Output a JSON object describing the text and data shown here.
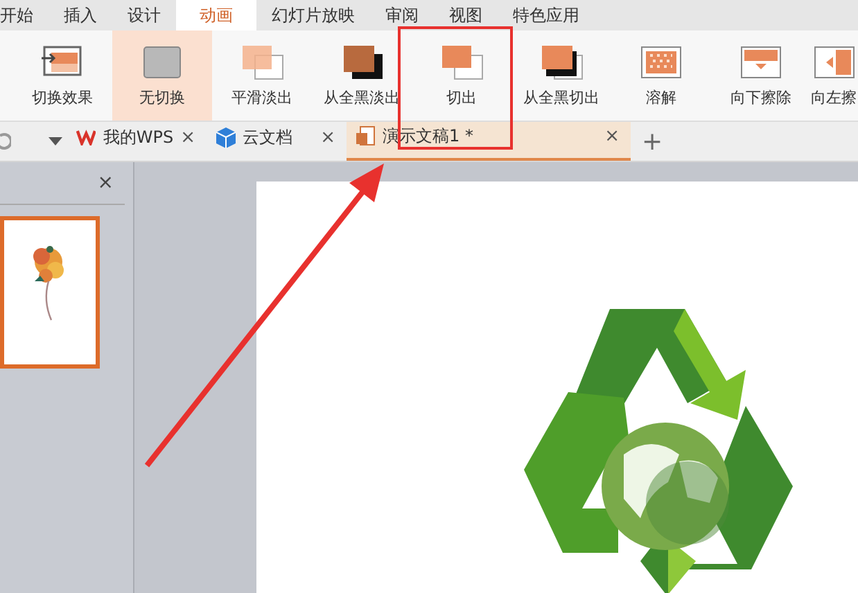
{
  "menu_tabs": [
    {
      "label": "开始",
      "selected": false
    },
    {
      "label": "插入",
      "selected": false
    },
    {
      "label": "设计",
      "selected": false
    },
    {
      "label": "动画",
      "selected": true
    },
    {
      "label": "幻灯片放映",
      "selected": false
    },
    {
      "label": "审阅",
      "selected": false
    },
    {
      "label": "视图",
      "selected": false
    },
    {
      "label": "特色应用",
      "selected": false
    }
  ],
  "ribbon": [
    {
      "label": "切换效果",
      "kind": "effect",
      "selected": false
    },
    {
      "label": "无切换",
      "kind": "none",
      "selected": true
    },
    {
      "label": "平滑淡出",
      "kind": "fade",
      "selected": false
    },
    {
      "label": "从全黑淡出",
      "kind": "black-fade",
      "selected": false
    },
    {
      "label": "切出",
      "kind": "cut",
      "selected": false
    },
    {
      "label": "从全黑切出",
      "kind": "black-cut",
      "selected": false
    },
    {
      "label": "溶解",
      "kind": "dissolve",
      "selected": false
    },
    {
      "label": "向下擦除",
      "kind": "wipe-down",
      "selected": false
    },
    {
      "label": "向左擦",
      "kind": "wipe-left",
      "selected": false
    }
  ],
  "doc_tabs": [
    {
      "label": "我的WPS",
      "kind": "wps",
      "selected": false,
      "close": "×"
    },
    {
      "label": "云文档",
      "kind": "cloud",
      "selected": false,
      "close": "×"
    },
    {
      "label": "演示文稿1 *",
      "kind": "doc",
      "selected": true,
      "close": "×"
    }
  ],
  "new_tab": "+",
  "panel": {
    "close": "×",
    "slides": [
      {
        "selected": true
      }
    ]
  }
}
